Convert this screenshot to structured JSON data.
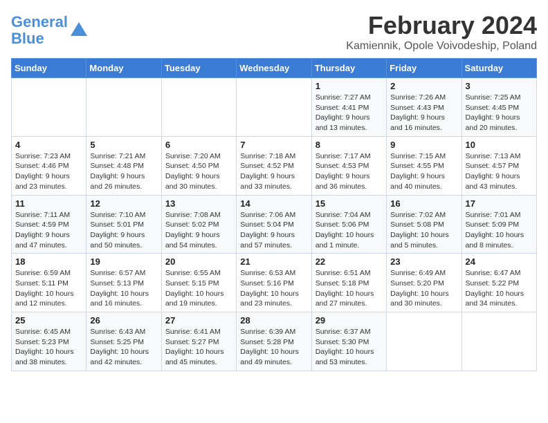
{
  "logo": {
    "text_general": "General",
    "text_blue": "Blue"
  },
  "title": "February 2024",
  "location": "Kamiennik, Opole Voivodeship, Poland",
  "weekdays": [
    "Sunday",
    "Monday",
    "Tuesday",
    "Wednesday",
    "Thursday",
    "Friday",
    "Saturday"
  ],
  "weeks": [
    [
      {
        "day": "",
        "info": ""
      },
      {
        "day": "",
        "info": ""
      },
      {
        "day": "",
        "info": ""
      },
      {
        "day": "",
        "info": ""
      },
      {
        "day": "1",
        "info": "Sunrise: 7:27 AM\nSunset: 4:41 PM\nDaylight: 9 hours\nand 13 minutes."
      },
      {
        "day": "2",
        "info": "Sunrise: 7:26 AM\nSunset: 4:43 PM\nDaylight: 9 hours\nand 16 minutes."
      },
      {
        "day": "3",
        "info": "Sunrise: 7:25 AM\nSunset: 4:45 PM\nDaylight: 9 hours\nand 20 minutes."
      }
    ],
    [
      {
        "day": "4",
        "info": "Sunrise: 7:23 AM\nSunset: 4:46 PM\nDaylight: 9 hours\nand 23 minutes."
      },
      {
        "day": "5",
        "info": "Sunrise: 7:21 AM\nSunset: 4:48 PM\nDaylight: 9 hours\nand 26 minutes."
      },
      {
        "day": "6",
        "info": "Sunrise: 7:20 AM\nSunset: 4:50 PM\nDaylight: 9 hours\nand 30 minutes."
      },
      {
        "day": "7",
        "info": "Sunrise: 7:18 AM\nSunset: 4:52 PM\nDaylight: 9 hours\nand 33 minutes."
      },
      {
        "day": "8",
        "info": "Sunrise: 7:17 AM\nSunset: 4:53 PM\nDaylight: 9 hours\nand 36 minutes."
      },
      {
        "day": "9",
        "info": "Sunrise: 7:15 AM\nSunset: 4:55 PM\nDaylight: 9 hours\nand 40 minutes."
      },
      {
        "day": "10",
        "info": "Sunrise: 7:13 AM\nSunset: 4:57 PM\nDaylight: 9 hours\nand 43 minutes."
      }
    ],
    [
      {
        "day": "11",
        "info": "Sunrise: 7:11 AM\nSunset: 4:59 PM\nDaylight: 9 hours\nand 47 minutes."
      },
      {
        "day": "12",
        "info": "Sunrise: 7:10 AM\nSunset: 5:01 PM\nDaylight: 9 hours\nand 50 minutes."
      },
      {
        "day": "13",
        "info": "Sunrise: 7:08 AM\nSunset: 5:02 PM\nDaylight: 9 hours\nand 54 minutes."
      },
      {
        "day": "14",
        "info": "Sunrise: 7:06 AM\nSunset: 5:04 PM\nDaylight: 9 hours\nand 57 minutes."
      },
      {
        "day": "15",
        "info": "Sunrise: 7:04 AM\nSunset: 5:06 PM\nDaylight: 10 hours\nand 1 minute."
      },
      {
        "day": "16",
        "info": "Sunrise: 7:02 AM\nSunset: 5:08 PM\nDaylight: 10 hours\nand 5 minutes."
      },
      {
        "day": "17",
        "info": "Sunrise: 7:01 AM\nSunset: 5:09 PM\nDaylight: 10 hours\nand 8 minutes."
      }
    ],
    [
      {
        "day": "18",
        "info": "Sunrise: 6:59 AM\nSunset: 5:11 PM\nDaylight: 10 hours\nand 12 minutes."
      },
      {
        "day": "19",
        "info": "Sunrise: 6:57 AM\nSunset: 5:13 PM\nDaylight: 10 hours\nand 16 minutes."
      },
      {
        "day": "20",
        "info": "Sunrise: 6:55 AM\nSunset: 5:15 PM\nDaylight: 10 hours\nand 19 minutes."
      },
      {
        "day": "21",
        "info": "Sunrise: 6:53 AM\nSunset: 5:16 PM\nDaylight: 10 hours\nand 23 minutes."
      },
      {
        "day": "22",
        "info": "Sunrise: 6:51 AM\nSunset: 5:18 PM\nDaylight: 10 hours\nand 27 minutes."
      },
      {
        "day": "23",
        "info": "Sunrise: 6:49 AM\nSunset: 5:20 PM\nDaylight: 10 hours\nand 30 minutes."
      },
      {
        "day": "24",
        "info": "Sunrise: 6:47 AM\nSunset: 5:22 PM\nDaylight: 10 hours\nand 34 minutes."
      }
    ],
    [
      {
        "day": "25",
        "info": "Sunrise: 6:45 AM\nSunset: 5:23 PM\nDaylight: 10 hours\nand 38 minutes."
      },
      {
        "day": "26",
        "info": "Sunrise: 6:43 AM\nSunset: 5:25 PM\nDaylight: 10 hours\nand 42 minutes."
      },
      {
        "day": "27",
        "info": "Sunrise: 6:41 AM\nSunset: 5:27 PM\nDaylight: 10 hours\nand 45 minutes."
      },
      {
        "day": "28",
        "info": "Sunrise: 6:39 AM\nSunset: 5:28 PM\nDaylight: 10 hours\nand 49 minutes."
      },
      {
        "day": "29",
        "info": "Sunrise: 6:37 AM\nSunset: 5:30 PM\nDaylight: 10 hours\nand 53 minutes."
      },
      {
        "day": "",
        "info": ""
      },
      {
        "day": "",
        "info": ""
      }
    ]
  ]
}
